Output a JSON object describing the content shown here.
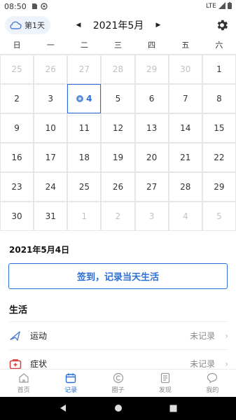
{
  "status_bar": {
    "time": "08:50",
    "network": "LTE"
  },
  "header": {
    "day_chip": "第1天",
    "month_title": "2021年5月",
    "prev": "◀",
    "next": "▶"
  },
  "weekdays": [
    "日",
    "一",
    "二",
    "三",
    "四",
    "五",
    "六"
  ],
  "calendar": {
    "weeks": [
      [
        {
          "d": "25",
          "other": true
        },
        {
          "d": "26",
          "other": true
        },
        {
          "d": "27",
          "other": true
        },
        {
          "d": "28",
          "other": true
        },
        {
          "d": "29",
          "other": true
        },
        {
          "d": "30",
          "other": true
        },
        {
          "d": "1",
          "other": false
        }
      ],
      [
        {
          "d": "2",
          "other": false
        },
        {
          "d": "3",
          "other": false
        },
        {
          "d": "4",
          "other": false,
          "selected": true
        },
        {
          "d": "5",
          "other": false
        },
        {
          "d": "6",
          "other": false
        },
        {
          "d": "7",
          "other": false
        },
        {
          "d": "8",
          "other": false
        }
      ],
      [
        {
          "d": "9",
          "other": false
        },
        {
          "d": "10",
          "other": false
        },
        {
          "d": "11",
          "other": false
        },
        {
          "d": "12",
          "other": false
        },
        {
          "d": "13",
          "other": false
        },
        {
          "d": "14",
          "other": false
        },
        {
          "d": "15",
          "other": false
        }
      ],
      [
        {
          "d": "16",
          "other": false
        },
        {
          "d": "17",
          "other": false
        },
        {
          "d": "18",
          "other": false
        },
        {
          "d": "19",
          "other": false
        },
        {
          "d": "20",
          "other": false
        },
        {
          "d": "21",
          "other": false
        },
        {
          "d": "22",
          "other": false
        }
      ],
      [
        {
          "d": "23",
          "other": false
        },
        {
          "d": "24",
          "other": false
        },
        {
          "d": "25",
          "other": false
        },
        {
          "d": "26",
          "other": false
        },
        {
          "d": "27",
          "other": false
        },
        {
          "d": "28",
          "other": false
        },
        {
          "d": "29",
          "other": false
        }
      ],
      [
        {
          "d": "30",
          "other": false
        },
        {
          "d": "31",
          "other": false
        },
        {
          "d": "1",
          "other": true
        },
        {
          "d": "2",
          "other": true
        },
        {
          "d": "3",
          "other": true
        },
        {
          "d": "4",
          "other": true
        },
        {
          "d": "5",
          "other": true
        }
      ]
    ]
  },
  "selected_date": "2021年5月4日",
  "checkin_button": "签到，记录当天生活",
  "life_section": {
    "title": "生活",
    "rows": [
      {
        "label": "运动",
        "status": "未记录",
        "icon": "shuttlecock-icon"
      },
      {
        "label": "症状",
        "status": "未记录",
        "icon": "medical-kit-icon"
      }
    ]
  },
  "tabs": [
    {
      "label": "首页",
      "icon": "home-icon",
      "active": false
    },
    {
      "label": "记录",
      "icon": "calendar-icon",
      "active": true
    },
    {
      "label": "圈子",
      "icon": "circle-c-icon",
      "active": false
    },
    {
      "label": "发现",
      "icon": "document-icon",
      "active": false
    },
    {
      "label": "我的",
      "icon": "chat-bubble-icon",
      "active": false
    }
  ],
  "colors": {
    "accent": "#2b6fd6",
    "muted": "#888888",
    "border": "#e6e6e6"
  }
}
